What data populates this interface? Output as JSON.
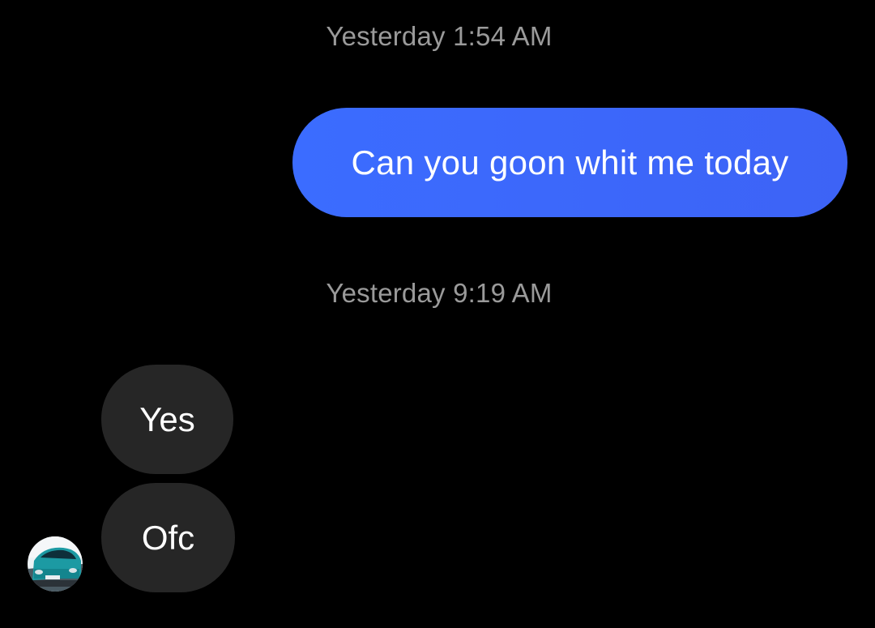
{
  "conversation": {
    "messages": [
      {
        "type": "timestamp",
        "text": "Yesterday 1:54 AM"
      },
      {
        "type": "outgoing",
        "text": "Can you goon whit me today"
      },
      {
        "type": "timestamp",
        "text": "Yesterday 9:19 AM"
      },
      {
        "type": "incoming",
        "text": "Yes"
      },
      {
        "type": "incoming",
        "text": "Ofc"
      }
    ],
    "sender_avatar_icon": "car-avatar-icon"
  },
  "colors": {
    "background": "#000000",
    "outgoing_bubble": "#3b6cff",
    "incoming_bubble": "#262626",
    "timestamp_text": "#9a9a9a",
    "message_text": "#ffffff"
  }
}
